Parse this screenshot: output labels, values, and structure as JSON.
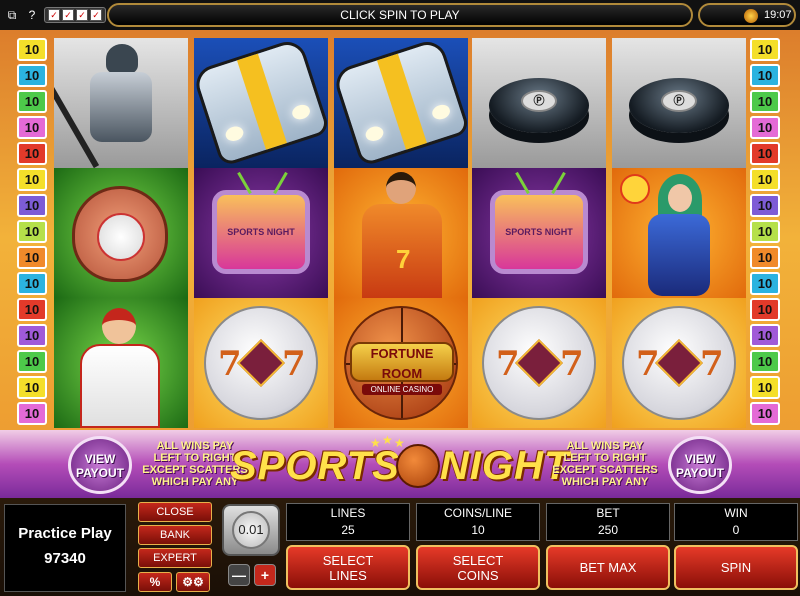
{
  "topbar": {
    "message": "CLICK SPIN TO PLAY",
    "time": "19:07",
    "icon_names": [
      "windows-icon",
      "help-icon",
      "settings-icon"
    ]
  },
  "lines_left": [
    "10",
    "10",
    "10",
    "10",
    "10",
    "10",
    "10",
    "10",
    "10",
    "10",
    "10",
    "10",
    "10",
    "10",
    "10"
  ],
  "lines_right": [
    "10",
    "10",
    "10",
    "10",
    "10",
    "10",
    "10",
    "10",
    "10",
    "10",
    "10",
    "10",
    "10",
    "10",
    "10"
  ],
  "line_colors": [
    "#f4df2a",
    "#2bb3e0",
    "#4dc94a",
    "#e46ad6",
    "#e23a2a",
    "#f4df2a",
    "#7d5cd6",
    "#b5e04a",
    "#f08a2a",
    "#2bb3e0",
    "#e23a2a",
    "#a05ad8",
    "#4dc94a",
    "#f4df2a",
    "#e46ad6"
  ],
  "reels": [
    [
      "hockey-player",
      "baseball-glove",
      "baseball-pitcher"
    ],
    [
      "race-car",
      "sports-tv",
      "soccer-ball-7"
    ],
    [
      "race-car",
      "soccer-player",
      "fortune-room-basketball"
    ],
    [
      "hockey-puck",
      "sports-tv",
      "soccer-ball-7"
    ],
    [
      "hockey-puck",
      "racer-girl",
      "soccer-ball-7"
    ]
  ],
  "symbol_text": {
    "tv": "SPORTS NIGHT",
    "puck": "Ⓟ",
    "fortune_line1": "FORTUNE",
    "fortune_line2": "ROOM",
    "fortune_line3": "ONLINE CASINO",
    "seven": "7"
  },
  "banner": {
    "view_payout_left": "VIEW\nPAYOUT",
    "view_payout_right": "VIEW\nPAYOUT",
    "all_wins_left": "ALL WINS PAY\nLEFT TO RIGHT\nEXCEPT SCATTERS\nWHICH PAY ANY",
    "all_wins_right": "ALL WINS PAY\nLEFT TO RIGHT\nEXCEPT SCATTERS\nWHICH PAY ANY",
    "logo_part1": "SPORTS",
    "logo_part2": "NIGHT"
  },
  "panel": {
    "practice_label": "Practice Play",
    "balance": "97340",
    "close": "CLOSE",
    "bank": "BANK",
    "expert": "EXPERT",
    "percent": "%",
    "gears": "⚙⚙",
    "coin_value": "0.01",
    "minus": "—",
    "plus": "+",
    "stats": {
      "lines_label": "LINES",
      "lines_value": "25",
      "coins_label": "COINS/LINE",
      "coins_value": "10",
      "bet_label": "BET",
      "bet_value": "250",
      "win_label": "WIN",
      "win_value": "0"
    },
    "buttons": {
      "select_lines": "SELECT\nLINES",
      "select_coins": "SELECT\nCOINS",
      "bet_max": "BET MAX",
      "spin": "SPIN"
    }
  },
  "colors": {
    "accent_gold": "#b18a3a",
    "button_red": "#c4281c",
    "logo_yellow": "#ffe14a"
  }
}
